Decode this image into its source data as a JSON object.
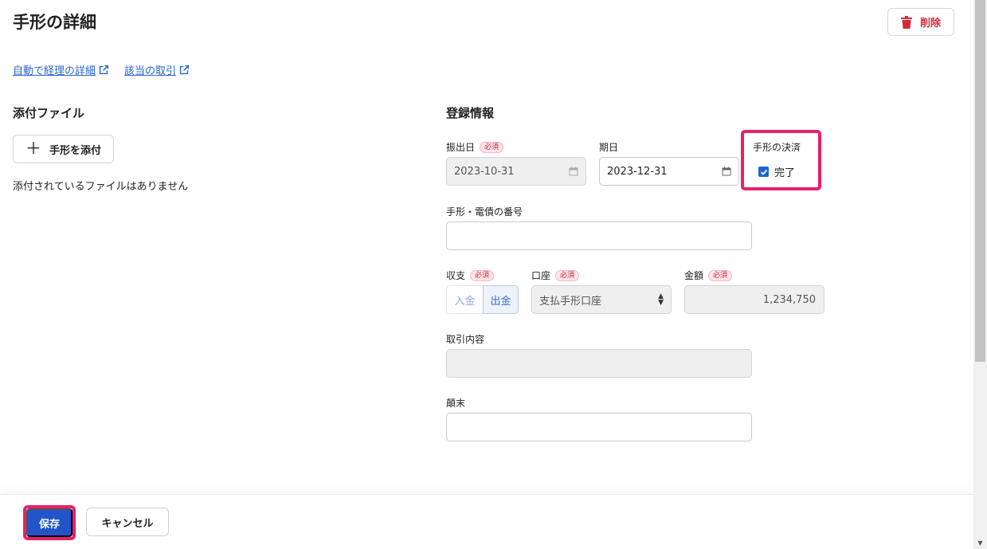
{
  "header": {
    "title": "手形の詳細",
    "delete_label": "削除"
  },
  "links": [
    {
      "label": "自動で経理の詳細"
    },
    {
      "label": "該当の取引"
    }
  ],
  "attachments": {
    "section_title": "添付ファイル",
    "add_label": "手形を添付",
    "empty_text": "添付されているファイルはありません"
  },
  "registration": {
    "section_title": "登録情報",
    "required_badge": "必須",
    "issue_date": {
      "label": "振出日",
      "value": "2023-10-31"
    },
    "due_date": {
      "label": "期日",
      "value": "2023-12-31"
    },
    "settlement": {
      "label": "手形の決済",
      "checkbox_label": "完了",
      "checked": true
    },
    "note_number": {
      "label": "手形・電債の番号",
      "value": ""
    },
    "income_expense": {
      "label": "収支",
      "options": [
        "入金",
        "出金"
      ],
      "selected": "出金"
    },
    "account": {
      "label": "口座",
      "value": "支払手形口座"
    },
    "amount": {
      "label": "金額",
      "value": "1,234,750"
    },
    "description": {
      "label": "取引内容",
      "value": ""
    },
    "summary": {
      "label": "顛末",
      "value": ""
    }
  },
  "footer": {
    "save_label": "保存",
    "cancel_label": "キャンセル"
  },
  "colors": {
    "primary": "#2155c9",
    "danger": "#d7273a",
    "highlight": "#e8206b",
    "link": "#2864c8"
  }
}
